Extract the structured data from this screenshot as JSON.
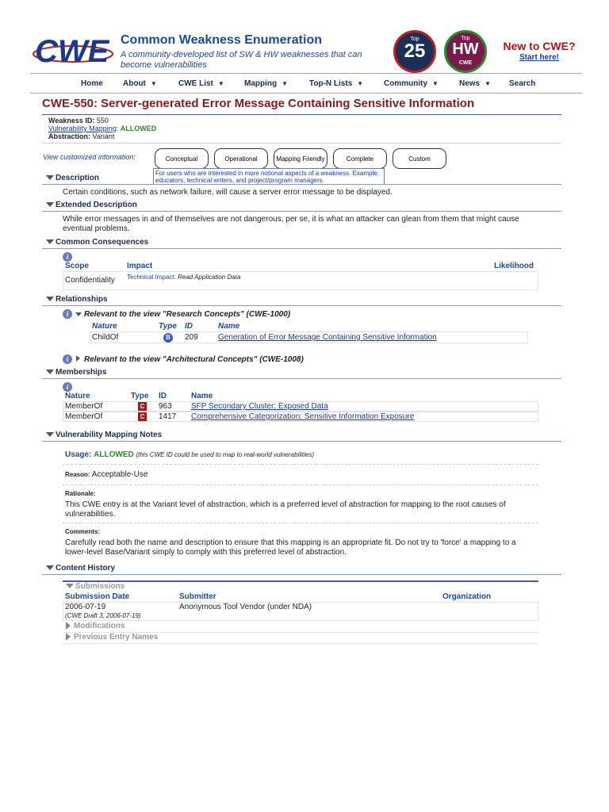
{
  "header": {
    "site_title": "Common Weakness Enumeration",
    "tagline": "A community-developed list of SW & HW weaknesses that can become vulnerabilities",
    "top25_small": "Top",
    "top25_num": "25",
    "tophw_small": "Top",
    "tophw_num": "HW",
    "tophw_sub": "CWE",
    "new_title": "New to CWE?",
    "new_link": "Start here!"
  },
  "nav": {
    "home": "Home",
    "about": "About",
    "cwe_list": "CWE List",
    "mapping": "Mapping",
    "topn": "Top-N Lists",
    "community": "Community",
    "news": "News",
    "search": "Search"
  },
  "page": {
    "title": "CWE-550: Server-generated Error Message Containing Sensitive Information",
    "weakness_id_label": "Weakness ID:",
    "weakness_id": "550",
    "vuln_mapping_label": "Vulnerability Mapping",
    "vuln_mapping_value": "ALLOWED",
    "abstraction_label": "Abstraction:",
    "abstraction": "Variant"
  },
  "views": {
    "label": "View customized information:",
    "buttons": [
      "Conceptual",
      "Operational",
      "Mapping Friendly",
      "Complete",
      "Custom"
    ],
    "tip": "For users who are interested in more notional aspects of a weakness. Example: educators, technical writers, and project/program managers."
  },
  "description": {
    "heading": "Description",
    "text": "Certain conditions, such as network failure, will cause a server error message to be displayed."
  },
  "extended": {
    "heading": "Extended Description",
    "text": "While error messages in and of themselves are not dangerous, per se, it is what an attacker can glean from them that might cause eventual problems."
  },
  "consequences": {
    "heading": "Common Consequences",
    "col_scope": "Scope",
    "col_impact": "Impact",
    "col_likelihood": "Likelihood",
    "scope": "Confidentiality",
    "impact_label": "Technical Impact:",
    "impact": "Read Application Data"
  },
  "relationships": {
    "heading": "Relationships",
    "view1": "Relevant to the view \"Research Concepts\" (CWE-1000)",
    "cols": [
      "Nature",
      "Type",
      "ID",
      "Name"
    ],
    "row_nature": "ChildOf",
    "row_type": "B",
    "row_id": "209",
    "row_name": "Generation of Error Message Containing Sensitive Information",
    "view2": "Relevant to the view \"Architectural Concepts\" (CWE-1008)"
  },
  "memberships": {
    "heading": "Memberships",
    "cols": [
      "Nature",
      "Type",
      "ID",
      "Name"
    ],
    "rows": [
      {
        "nature": "MemberOf",
        "type": "C",
        "id": "963",
        "name": "SFP Secondary Cluster: Exposed Data"
      },
      {
        "nature": "MemberOf",
        "type": "C",
        "id": "1417",
        "name": "Comprehensive Categorization: Sensitive Information Exposure"
      }
    ]
  },
  "mapping_notes": {
    "heading": "Vulnerability Mapping Notes",
    "usage_label": "Usage:",
    "usage_value": "ALLOWED",
    "usage_note": "(this CWE ID could be used to map to real-world vulnerabilities)",
    "reason_label": "Reason:",
    "reason": "Acceptable-Use",
    "rationale_label": "Rationale:",
    "rationale": "This CWE entry is at the Variant level of abstraction, which is a preferred level of abstraction for mapping to the root causes of vulnerabilities.",
    "comments_label": "Comments:",
    "comments": "Carefully read both the name and description to ensure that this mapping is an appropriate fit. Do not try to 'force' a mapping to a lower-level Base/Variant simply to comply with this preferred level of abstraction."
  },
  "history": {
    "heading": "Content History",
    "submissions": "Submissions",
    "col_date": "Submission Date",
    "col_submitter": "Submitter",
    "col_org": "Organization",
    "date": "2006-07-19",
    "draft": "(CWE Draft 3, 2006-07-19)",
    "submitter": "Anonymous Tool Vendor (under NDA)",
    "modifications": "Modifications",
    "previous": "Previous Entry Names"
  }
}
